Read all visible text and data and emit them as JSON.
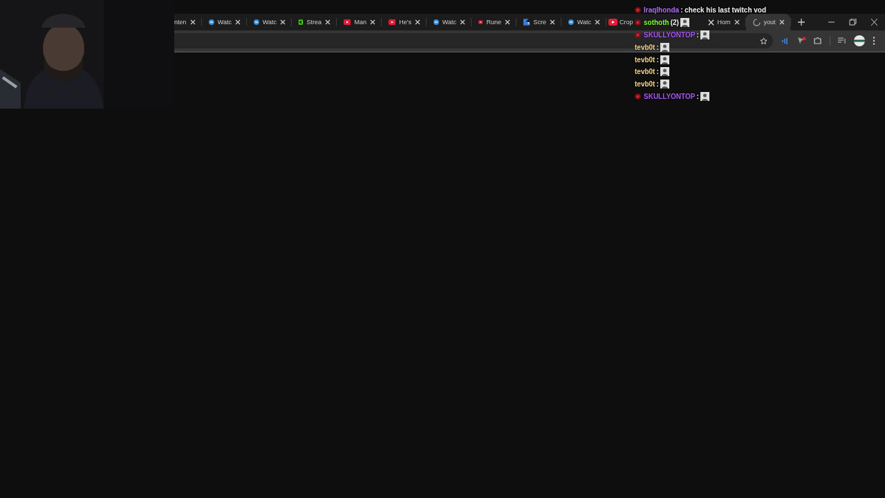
{
  "tabs": [
    {
      "label": "nten",
      "kind": "cut",
      "selected": false
    },
    {
      "label": "Watc",
      "kind": "loop",
      "selected": false
    },
    {
      "label": "Watc",
      "kind": "loop",
      "selected": false
    },
    {
      "label": "Strea",
      "kind": "kick",
      "selected": false
    },
    {
      "label": "Man",
      "kind": "video",
      "selected": false
    },
    {
      "label": "He's",
      "kind": "video",
      "selected": false
    },
    {
      "label": "Watc",
      "kind": "loop",
      "selected": false
    },
    {
      "label": "Rune",
      "kind": "video",
      "selected": false
    },
    {
      "label": "Scre",
      "kind": "shot",
      "selected": false
    },
    {
      "label": "Watc",
      "kind": "loop",
      "selected": false
    },
    {
      "label": "Crop",
      "kind": "covered",
      "selected": false
    },
    {
      "label": "Hom",
      "kind": "social",
      "selected": false
    },
    {
      "label": "yout",
      "kind": "loading",
      "selected": true
    }
  ],
  "chat": [
    {
      "badge": true,
      "user": "Iraqlhonda",
      "color": "#b06cff",
      "text": ": check his last twitch vod",
      "emote": false
    },
    {
      "badge": true,
      "user": "sothoth",
      "color": "#7cff2e",
      "text": "(2)",
      "emote": true
    },
    {
      "badge": true,
      "user": "SKULLYONTOP",
      "color": "#a855f7",
      "text": ":",
      "emote": true
    },
    {
      "badge": false,
      "user": "tevb0t",
      "color": "#f2d58c",
      "text": ":",
      "emote": true
    },
    {
      "badge": false,
      "user": "tevb0t",
      "color": "#f2d58c",
      "text": ":",
      "emote": true
    },
    {
      "badge": false,
      "user": "tevb0t",
      "color": "#f2d58c",
      "text": ":",
      "emote": true
    },
    {
      "badge": false,
      "user": "tevb0t",
      "color": "#f2d58c",
      "text": ":",
      "emote": true
    },
    {
      "badge": true,
      "user": "SKULLYONTOP",
      "color": "#a855f7",
      "text": ":",
      "emote": true
    }
  ]
}
